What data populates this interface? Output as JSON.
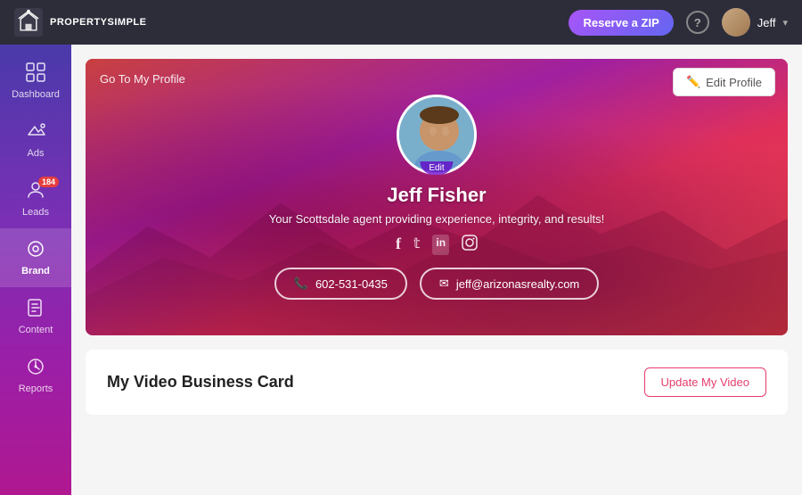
{
  "topnav": {
    "logo_text": "PROPERTYSIMPLE",
    "reserve_zip_label": "Reserve a ZIP",
    "help_label": "?",
    "user_name": "Jeff",
    "chevron": "▾"
  },
  "sidebar": {
    "items": [
      {
        "id": "dashboard",
        "label": "Dashboard",
        "icon": "⊞",
        "active": false
      },
      {
        "id": "ads",
        "label": "Ads",
        "icon": "📢",
        "active": false
      },
      {
        "id": "leads",
        "label": "Leads",
        "icon": "👤",
        "active": false,
        "badge": "184"
      },
      {
        "id": "brand",
        "label": "Brand",
        "icon": "🏷",
        "active": true
      },
      {
        "id": "content",
        "label": "Content",
        "icon": "📄",
        "active": false
      },
      {
        "id": "reports",
        "label": "Reports",
        "icon": "📊",
        "active": false
      }
    ]
  },
  "banner": {
    "go_to_profile": "Go To My Profile",
    "edit_profile": "Edit Profile",
    "edit_icon": "✏️",
    "user_name": "Jeff Fisher",
    "tagline": "Your Scottsdale agent providing experience, integrity, and results!",
    "social": [
      {
        "name": "facebook",
        "icon": "f"
      },
      {
        "name": "twitter",
        "icon": "t"
      },
      {
        "name": "linkedin",
        "icon": "in"
      },
      {
        "name": "instagram",
        "icon": "ig"
      }
    ],
    "phone": "602-531-0435",
    "email": "jeff@arizonasrealty.com",
    "phone_icon": "📞",
    "email_icon": "✉",
    "edit_avatar_label": "Edit"
  },
  "video_section": {
    "title": "My Video Business Card",
    "update_btn_label": "Update My Video"
  }
}
